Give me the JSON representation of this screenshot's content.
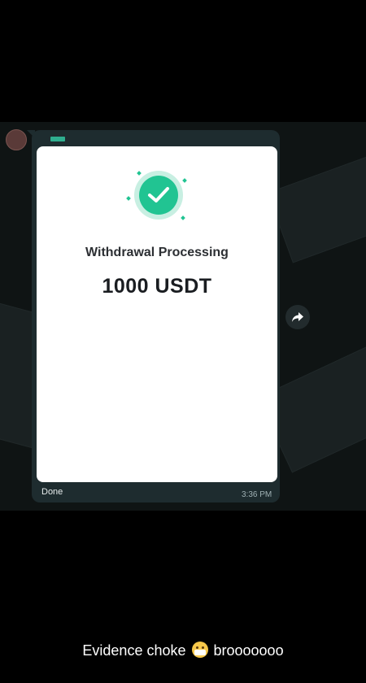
{
  "message": {
    "card": {
      "status_title": "Withdrawal Processing",
      "amount": "1000 USDT",
      "status_icon": "checkmark-icon"
    },
    "caption_text": "Done",
    "timestamp": "3:36 PM"
  },
  "story_caption": {
    "before_emoji": "Evidence choke ",
    "emoji": "face-with-medical-mask",
    "after_emoji": " brooooooo"
  },
  "colors": {
    "success": "#21c492",
    "bubble": "#1e2c2f"
  }
}
